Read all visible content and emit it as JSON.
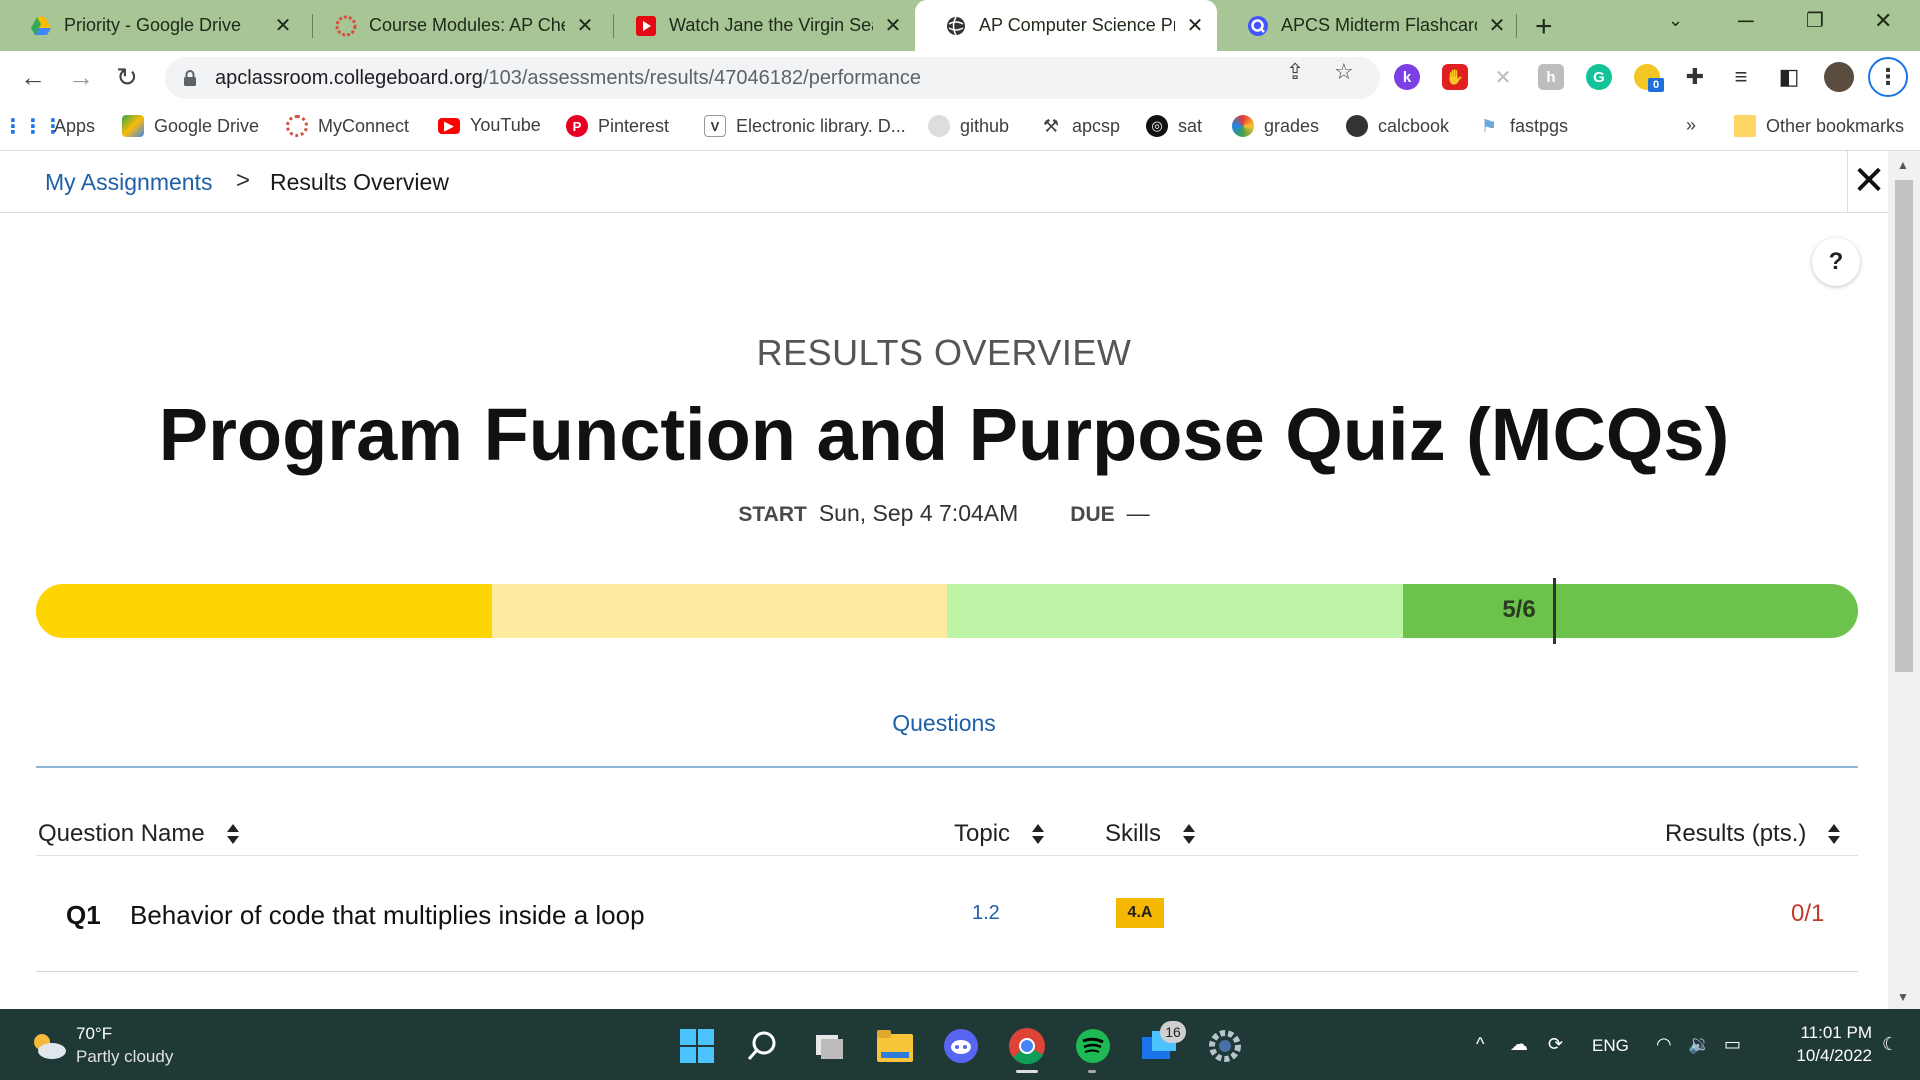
{
  "browser": {
    "tabs": [
      {
        "title": "Priority - Google Drive",
        "favicon": "google-drive-icon"
      },
      {
        "title": "Course Modules: AP Chem",
        "favicon": "myconnect-icon"
      },
      {
        "title": "Watch Jane the Virgin Sea",
        "favicon": "netflix-play-icon"
      },
      {
        "title": "AP Computer Science Prin",
        "favicon": "globe-icon"
      },
      {
        "title": "APCS Midterm Flashcards",
        "favicon": "quizlet-icon"
      }
    ],
    "url_host": "apclassroom.collegeboard.org",
    "url_path": "/103/assessments/results/47046182/performance",
    "extension_badge": "0"
  },
  "bookmarks": {
    "items": [
      "Apps",
      "Google Drive",
      "MyConnect",
      "YouTube",
      "Pinterest",
      "Electronic library. D...",
      "github",
      "apcsp",
      "sat",
      "grades",
      "calcbook",
      "fastpgs"
    ],
    "overflow": "»",
    "other": "Other bookmarks"
  },
  "page": {
    "breadcrumb": {
      "parent": "My Assignments",
      "separator": ">",
      "current": "Results Overview"
    },
    "help": "?",
    "overview_label": "RESULTS OVERVIEW",
    "title": "Program Function and Purpose Quiz (MCQs)",
    "start_label": "START",
    "start_value": "Sun, Sep 4 7:04AM",
    "due_label": "DUE",
    "due_value": "—",
    "score": {
      "label": "5/6",
      "earned": 5,
      "possible": 6,
      "segment_colors": [
        "#fed500",
        "#ffeba0",
        "#bdf4a6",
        "#6cc24a"
      ]
    },
    "questions_tab": "Questions",
    "columns": {
      "name": "Question Name",
      "topic": "Topic",
      "skills": "Skills",
      "results": "Results (pts.)"
    },
    "questions": [
      {
        "number": "Q1",
        "name": "Behavior of code that multiplies inside a loop",
        "topic": "1.2",
        "skill": "4.A",
        "result": "0/1"
      }
    ]
  },
  "taskbar": {
    "weather_temp": "70°F",
    "weather_condition": "Partly cloudy",
    "mail_badge": "16",
    "language": "ENG",
    "time": "11:01 PM",
    "date": "10/4/2022"
  }
}
